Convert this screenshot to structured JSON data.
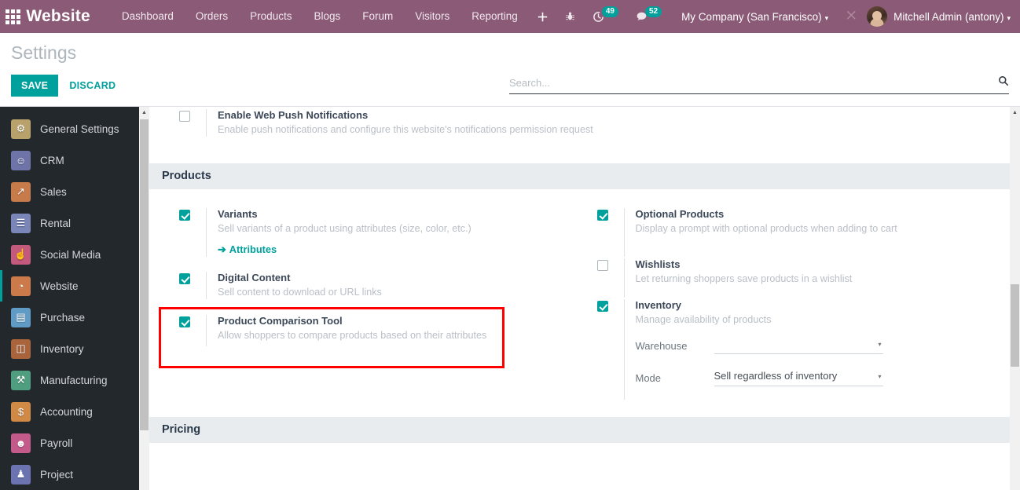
{
  "navbar": {
    "apps_icon": "apps-grid-icon",
    "brand": "Website",
    "links": [
      "Dashboard",
      "Orders",
      "Products",
      "Blogs",
      "Forum",
      "Visitors",
      "Reporting"
    ],
    "plus_icon": "plus-icon",
    "bug_icon": "bug-icon",
    "activity_icon": "clock-icon",
    "activity_count": "49",
    "messages_icon": "chat-icon",
    "messages_count": "52",
    "company": "My Company (San Francisco)",
    "tools_icon": "wrench-icon",
    "user": "Mitchell Admin (antony)",
    "caret": "▾"
  },
  "control_panel": {
    "title": "Settings",
    "save_label": "SAVE",
    "discard_label": "DISCARD",
    "search_placeholder": "Search...",
    "search_value": "",
    "search_icon": "search-icon"
  },
  "sidebar": {
    "items": [
      {
        "label": "General Settings",
        "icon": "gear-icon",
        "glyph": "⚙",
        "color": "#b9a16b",
        "active": false
      },
      {
        "label": "CRM",
        "icon": "handshake-icon",
        "glyph": "☺",
        "color": "#6e74a8",
        "active": false
      },
      {
        "label": "Sales",
        "icon": "chart-icon",
        "glyph": "↗",
        "color": "#c77a4a",
        "active": false
      },
      {
        "label": "Rental",
        "icon": "calendar-icon",
        "glyph": "☰",
        "color": "#7a86b8",
        "active": false
      },
      {
        "label": "Social Media",
        "icon": "thumbs-up-icon",
        "glyph": "☝",
        "color": "#c4597e",
        "active": false
      },
      {
        "label": "Website",
        "icon": "globe-icon",
        "glyph": "◔",
        "color": "#cc7a4a",
        "active": true
      },
      {
        "label": "Purchase",
        "icon": "card-icon",
        "glyph": "▤",
        "color": "#5f9bc4",
        "active": false
      },
      {
        "label": "Inventory",
        "icon": "box-icon",
        "glyph": "◫",
        "color": "#a9643c",
        "active": false
      },
      {
        "label": "Manufacturing",
        "icon": "wrench-icon",
        "glyph": "⚒",
        "color": "#4f9e7f",
        "active": false
      },
      {
        "label": "Accounting",
        "icon": "invoice-icon",
        "glyph": "$",
        "color": "#d08a45",
        "active": false
      },
      {
        "label": "Payroll",
        "icon": "person-pay-icon",
        "glyph": "☻",
        "color": "#c45a8a",
        "active": false
      },
      {
        "label": "Project",
        "icon": "project-icon",
        "glyph": "♟",
        "color": "#6b74b0",
        "active": false
      }
    ]
  },
  "settings": {
    "push_notifications": {
      "checked": false,
      "label": "Enable Web Push Notifications",
      "desc": "Enable push notifications and configure this website's notifications permission request"
    },
    "products_section": {
      "title": "Products",
      "left": [
        {
          "checked": true,
          "label": "Variants",
          "desc": "Sell variants of a product using attributes (size, color, etc.)",
          "link": "Attributes",
          "link_arrow": "➔"
        },
        {
          "checked": true,
          "label": "Digital Content",
          "desc": "Sell content to download or URL links"
        },
        {
          "checked": true,
          "label": "Product Comparison Tool",
          "desc": "Allow shoppers to compare products based on their attributes",
          "highlighted": true
        }
      ],
      "right": [
        {
          "checked": true,
          "label": "Optional Products",
          "desc": "Display a prompt with optional products when adding to cart"
        },
        {
          "checked": false,
          "label": "Wishlists",
          "desc": "Let returning shoppers save products in a wishlist"
        },
        {
          "checked": true,
          "label": "Inventory",
          "desc": "Manage availability of products",
          "fields": [
            {
              "label": "Warehouse",
              "value": "",
              "caret": "▾"
            },
            {
              "label": "Mode",
              "value": "Sell regardless of inventory",
              "caret": "▾"
            }
          ]
        }
      ]
    },
    "pricing_section": {
      "title": "Pricing"
    }
  },
  "highlight": {
    "color": "#ff0000",
    "target": "Product Comparison Tool"
  }
}
